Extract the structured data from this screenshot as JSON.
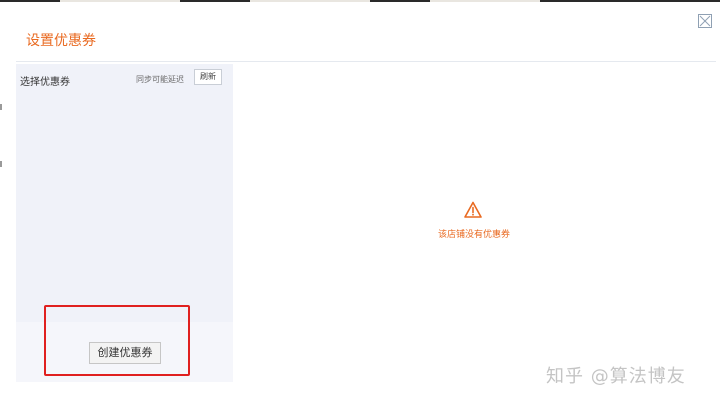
{
  "dialog": {
    "title": "设置优惠券"
  },
  "left_panel": {
    "label": "选择优惠券",
    "sync_note": "同步可能延迟",
    "refresh_label": "刷新",
    "create_label": "创建优惠券"
  },
  "empty_state": {
    "icon": "warning-triangle-icon",
    "message": "该店铺没有优惠券"
  },
  "watermark": "知乎 @算法博友",
  "colors": {
    "accent": "#e96a21",
    "panel_bg": "#f0f2f9",
    "highlight": "#e0201f"
  }
}
